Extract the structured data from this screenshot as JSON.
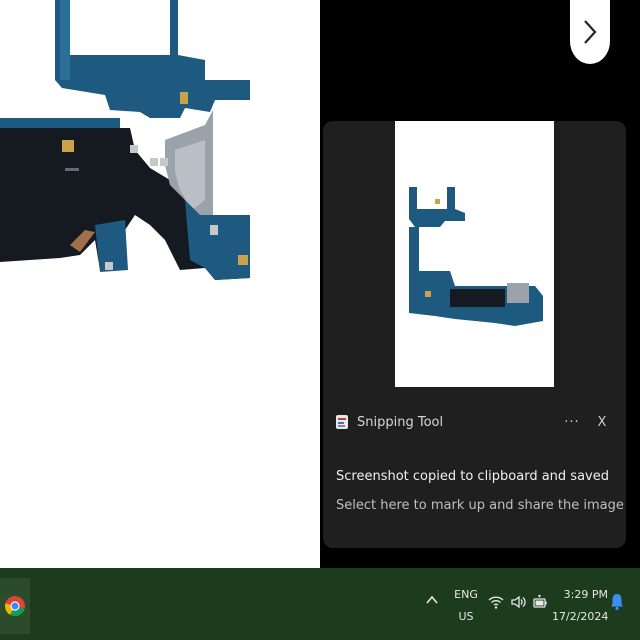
{
  "toast": {
    "app_name": "Snipping Tool",
    "more_label": "···",
    "close_label": "X",
    "title": "Screenshot copied to clipboard and saved",
    "body": "Select here to mark up and share the image"
  },
  "taskbar": {
    "lang_line1": "ENG",
    "lang_line2": "US",
    "time": "3:29 PM",
    "date": "17/2/2024"
  },
  "icons": {
    "next": "chevron-right-icon",
    "chrome": "chrome-icon",
    "wifi": "wifi-icon",
    "volume": "volume-icon",
    "battery": "battery-icon",
    "bell": "bell-icon"
  },
  "colors": {
    "taskbar": "#1d3b1d",
    "toast_bg": "#1f1f1f",
    "bell_accent": "#3d8ef5"
  }
}
